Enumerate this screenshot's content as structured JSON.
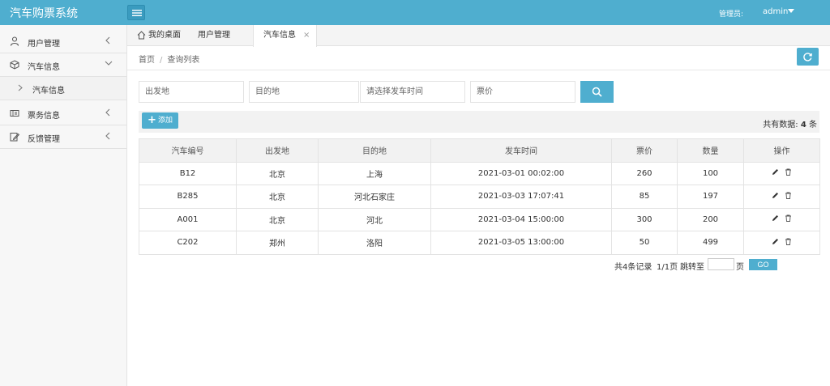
{
  "header": {
    "brand": "汽车购票系统",
    "admin_label": "管理员:",
    "admin_name": "admin"
  },
  "sidebar": {
    "items": [
      {
        "label": "用户管理",
        "icon": "user-icon"
      },
      {
        "label": "汽车信息",
        "icon": "cube-icon",
        "expanded": true,
        "children": [
          {
            "label": "汽车信息"
          }
        ]
      },
      {
        "label": "票务信息",
        "icon": "ticket-icon"
      },
      {
        "label": "反馈管理",
        "icon": "edit-icon"
      }
    ]
  },
  "tabs": [
    {
      "label": "我的桌面"
    },
    {
      "label": "用户管理"
    },
    {
      "label": "汽车信息",
      "active": true,
      "close": "×"
    }
  ],
  "breadcrumb": {
    "home": "首页",
    "sep": "/",
    "current": "查询列表"
  },
  "search": {
    "from_placeholder": "出发地",
    "to_placeholder": "目的地",
    "time_placeholder": "请选择发车时间",
    "price_placeholder": "票价"
  },
  "toolbar": {
    "add_label": "添加",
    "total_prefix": "共有数据:",
    "total_count": "4",
    "total_suffix": "条"
  },
  "table": {
    "headers": [
      "汽车编号",
      "出发地",
      "目的地",
      "发车时间",
      "票价",
      "数量",
      "操作"
    ],
    "rows": [
      [
        "B12",
        "北京",
        "上海",
        "2021-03-01 00:02:00",
        "260",
        "100"
      ],
      [
        "B285",
        "北京",
        "河北石家庄",
        "2021-03-03 17:07:41",
        "85",
        "197"
      ],
      [
        "A001",
        "北京",
        "河北",
        "2021-03-04 15:00:00",
        "300",
        "200"
      ],
      [
        "C202",
        "郑州",
        "洛阳",
        "2021-03-05 13:00:00",
        "50",
        "499"
      ]
    ]
  },
  "pager": {
    "records": "共4条记录",
    "pages": "1/1页",
    "jump_label": "跳转至",
    "page_unit": "页",
    "go_label": "GO"
  },
  "colors": {
    "accent": "#4faecf",
    "sidebar_bg": "#f7f7f7"
  }
}
